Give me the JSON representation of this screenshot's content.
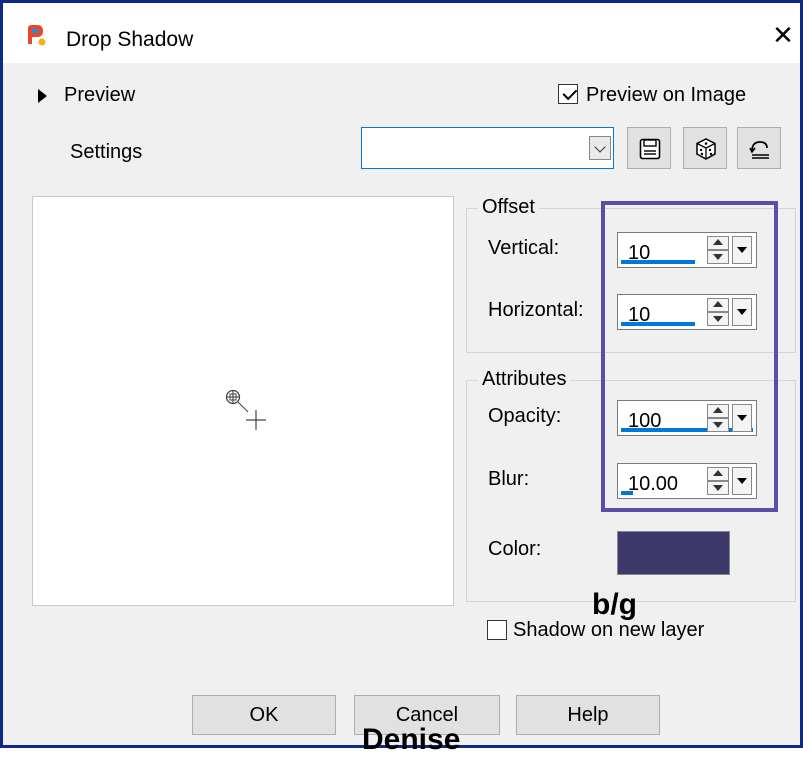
{
  "window": {
    "title": "Drop Shadow",
    "close_glyph": "✕"
  },
  "preview_toggle": {
    "label": "Preview"
  },
  "preview_on_image": {
    "label": "Preview on Image",
    "checked": true
  },
  "settings": {
    "label": "Settings",
    "value": ""
  },
  "icons": {
    "app": "paintshop-pro-icon",
    "save": "save-preset-icon",
    "randomize": "dice-icon",
    "reset": "reset-icon"
  },
  "offset": {
    "title": "Offset",
    "vertical": {
      "label": "Vertical:",
      "value": "10"
    },
    "horizontal": {
      "label": "Horizontal:",
      "value": "10"
    }
  },
  "attributes": {
    "title": "Attributes",
    "opacity": {
      "label": "Opacity:",
      "value": "100"
    },
    "blur": {
      "label": "Blur:",
      "value": "10.00"
    },
    "color": {
      "label": "Color:",
      "value": "#3d3a6b"
    }
  },
  "annotations": {
    "bg": "b/g",
    "signature": "Denise"
  },
  "shadow_on_new_layer": {
    "label": "Shadow on new layer",
    "checked": false
  },
  "buttons": {
    "ok": "OK",
    "cancel": "Cancel",
    "help": "Help"
  },
  "colors": {
    "frame": "#102a83",
    "highlight": "#5a4ea6",
    "accent": "#0078d7"
  }
}
